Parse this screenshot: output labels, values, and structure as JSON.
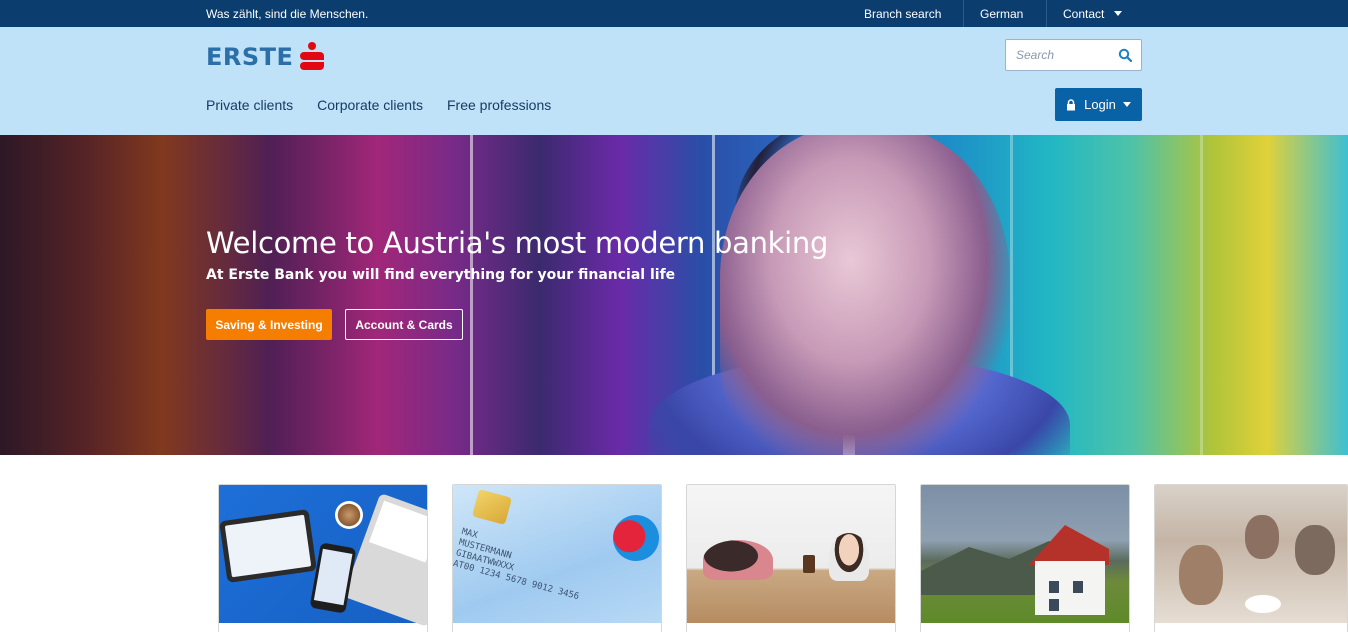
{
  "topbar": {
    "tagline": "Was zählt, sind die Menschen.",
    "branch_search": "Branch search",
    "language": "German",
    "contact": "Contact"
  },
  "header": {
    "logo_text": "ERSTE",
    "nav": [
      "Private clients",
      "Corporate clients",
      "Free professions"
    ],
    "search": {
      "placeholder": "Search",
      "value": ""
    },
    "login_label": "Login"
  },
  "hero": {
    "title": "Welcome to Austria's most modern banking",
    "subtitle": "At Erste Bank you will find everything for your financial life",
    "primary_button": "Saving & Investing",
    "secondary_button": "Account & Cards"
  },
  "cards": {
    "card_text": [
      "MAX",
      "MUSTERMANN",
      "GIBAATWWXXX",
      "AT00 1234 5678 9012 3456"
    ],
    "maestro": "Maestro",
    "bankcard": "BankCard"
  },
  "colors": {
    "topbar": "#0b3d6e",
    "header": "#bfe2f8",
    "login": "#0a62a6",
    "primary_button": "#f57d00",
    "logo_red": "#e30613",
    "logo_blue": "#2a6fa8"
  },
  "icons": [
    "search-icon",
    "lock-icon",
    "chevron-down-icon",
    "erste-s-logo-icon"
  ]
}
